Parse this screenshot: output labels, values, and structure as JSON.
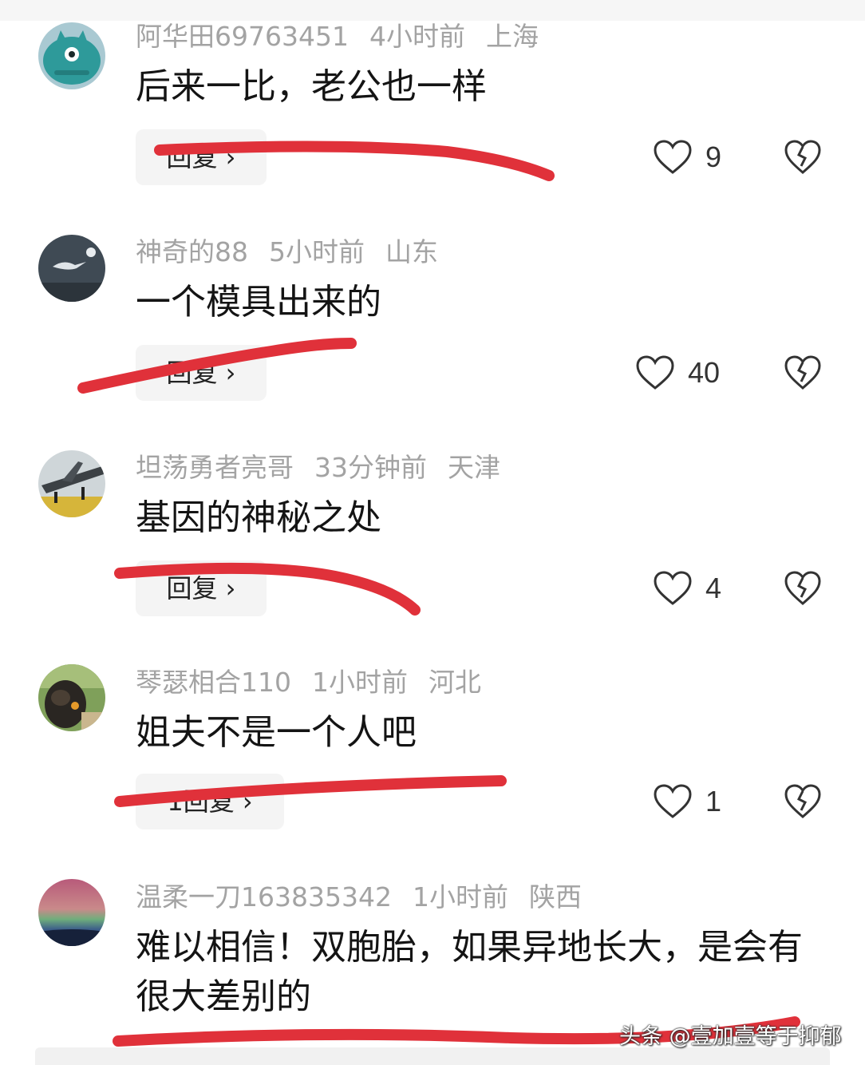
{
  "comments": [
    {
      "user": "阿华田69763451",
      "time": "4小时前",
      "location": "上海",
      "text": "后来一比，老公也一样",
      "reply_label": "回复 ›",
      "likes": "9",
      "avatar": "teal-monster-avatar"
    },
    {
      "user": "神奇的88",
      "time": "5小时前",
      "location": "山东",
      "text": "一个模具出来的",
      "reply_label": "回复 ›",
      "likes": "40",
      "avatar": "bird-night-avatar"
    },
    {
      "user": "坦荡勇者亮哥",
      "time": "33分钟前",
      "location": "天津",
      "text": "基因的神秘之处",
      "reply_label": "回复 ›",
      "likes": "4",
      "avatar": "airplane-avatar"
    },
    {
      "user": "琴瑟相合110",
      "time": "1小时前",
      "location": "河北",
      "text": "姐夫不是一个人吧",
      "reply_label": "1回复 ›",
      "likes": "1",
      "avatar": "cat-grass-avatar"
    },
    {
      "user": "温柔一刀163835342",
      "time": "1小时前",
      "location": "陕西",
      "text": "难以相信！双胞胎，如果异地长大，是会有很大差别的",
      "reply_label": "",
      "likes": "",
      "avatar": "aurora-avatar"
    }
  ],
  "watermark": "头条 @壹加壹等于抑郁",
  "colors": {
    "scribble": "#e0313a",
    "meta_text": "#a3a3a3",
    "reply_bg": "#f4f4f4"
  }
}
